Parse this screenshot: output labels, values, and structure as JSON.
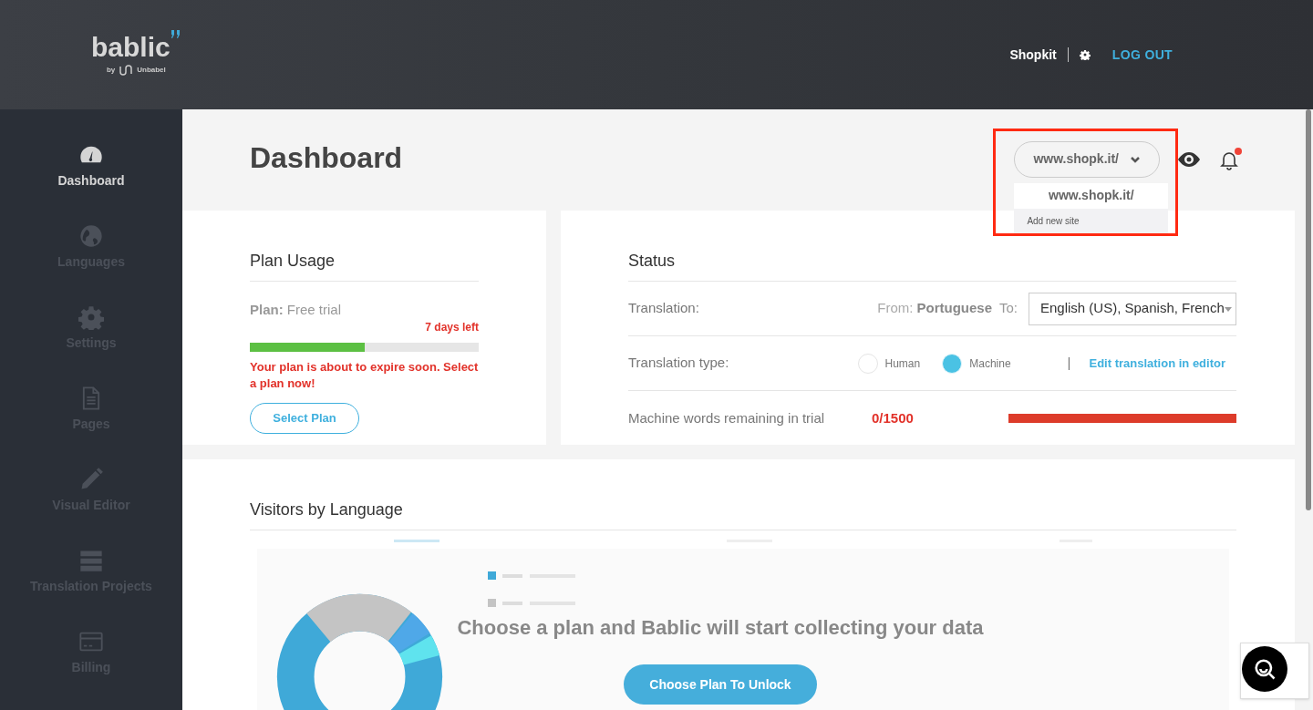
{
  "header": {
    "logo": "bablic",
    "logo_by": "by",
    "logo_company": "Unbabel",
    "user": "Shopkit",
    "logout": "LOG OUT"
  },
  "sidebar": {
    "items": [
      {
        "label": "Dashboard",
        "selected": true
      },
      {
        "label": "Languages",
        "selected": false
      },
      {
        "label": "Settings",
        "selected": false
      },
      {
        "label": "Pages",
        "selected": false
      },
      {
        "label": "Visual Editor",
        "selected": false
      },
      {
        "label": "Translation Projects",
        "selected": false
      },
      {
        "label": "Billing",
        "selected": false
      }
    ]
  },
  "page_title": "Dashboard",
  "site_select": {
    "value": "www.shopk.it/",
    "expanded": true,
    "options": [
      {
        "label": "www.shopk.it/",
        "kind": "site"
      },
      {
        "label": "Add new site",
        "kind": "action"
      }
    ]
  },
  "notifications": {
    "unread": true
  },
  "plan_usage": {
    "title": "Plan Usage",
    "plan_label": "Plan:",
    "plan_value": "Free trial",
    "days_left": "7 days left",
    "level": 0.5,
    "warning": "Your plan is about to expire soon. Select a plan now!",
    "button": "Select Plan"
  },
  "status": {
    "title": "Status",
    "translation_label": "Translation:",
    "from_label": "From:",
    "from_value": "Portuguese",
    "to_label": "To:",
    "to_value": "English (US), Spanish, French",
    "type_label": "Translation type:",
    "types": [
      {
        "label": "Human",
        "selected": false
      },
      {
        "label": "Machine",
        "selected": true
      }
    ],
    "separator": "|",
    "editor_link": "Edit translation in editor",
    "words": {
      "label": "Machine words remaining in trial",
      "value": "0/1500",
      "level": 1
    }
  },
  "visitors": {
    "title": "Visitors by Language",
    "locked_message": "Choose a plan and Bablic will start collecting your data",
    "unlock_button": "Choose Plan To Unlock"
  }
}
